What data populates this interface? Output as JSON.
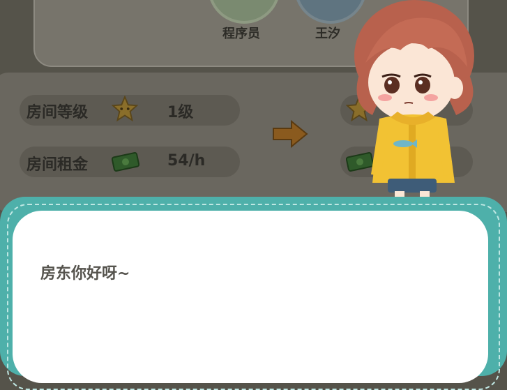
{
  "characters": [
    {
      "name": "程序员"
    },
    {
      "name": "王汐"
    }
  ],
  "room_stats": {
    "level_label": "房间等级",
    "level_value": "1级",
    "rent_label": "房间租金",
    "rent_value": "54/h"
  },
  "dialog": {
    "text": "房东你好呀~"
  },
  "colors": {
    "dialog_border": "#4eb0aa",
    "overlay": "#55534a"
  }
}
